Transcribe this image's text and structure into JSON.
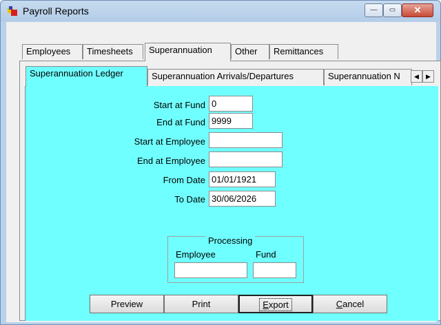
{
  "window": {
    "title": "Payroll Reports",
    "controls": {
      "minimize": "—",
      "maximize": "▭",
      "close": "✕"
    }
  },
  "outer_tabs": [
    "Employees",
    "Timesheets",
    "Superannuation",
    "Other",
    "Remittances"
  ],
  "outer_active": "Superannuation",
  "inner_tabs": [
    "Superannuation Ledger",
    "Superannuation Arrivals/Departures",
    "Superannuation N"
  ],
  "inner_active": "Superannuation Ledger",
  "tab_scroll": {
    "left": "◀",
    "right": "▶"
  },
  "form": {
    "start_fund_label": "Start at Fund",
    "start_fund_value": "0",
    "end_fund_label": "End at Fund",
    "end_fund_value": "9999",
    "start_employee_label": "Start at Employee",
    "start_employee_value": "",
    "end_employee_label": "End at Employee",
    "end_employee_value": "",
    "from_date_label": "From Date",
    "from_date_value": "01/01/1921",
    "to_date_label": "To Date",
    "to_date_value": "30/06/2026"
  },
  "processing": {
    "title": "Processing",
    "employee_label": "Employee",
    "fund_label": "Fund",
    "employee_value": "",
    "fund_value": ""
  },
  "buttons": {
    "preview": "Preview",
    "print": "Print",
    "export_accel": "E",
    "export_rest": "xport",
    "cancel_accel": "C",
    "cancel_rest": "ancel"
  },
  "colors": {
    "panel": "#70ffff",
    "window_frame": "#b9d1ea",
    "close_button": "#c74a36"
  }
}
